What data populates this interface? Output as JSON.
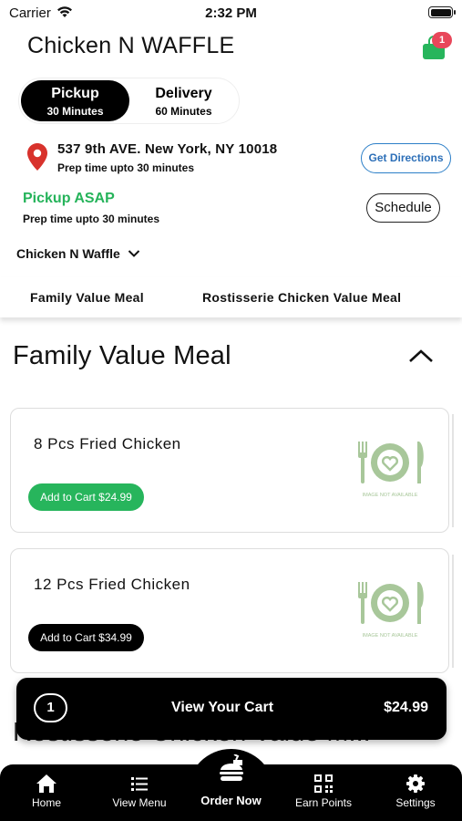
{
  "status_bar": {
    "carrier": "Carrier",
    "time": "2:32 PM"
  },
  "header": {
    "title": "Chicken N WAFFLE",
    "cart_badge": "1"
  },
  "order_mode": {
    "pickup": {
      "label": "Pickup",
      "time": "30 Minutes"
    },
    "delivery": {
      "label": "Delivery",
      "time": "60 Minutes"
    }
  },
  "location": {
    "address": "537 9th AVE. New York, NY 10018",
    "prep_time": "Prep time upto 30 minutes",
    "directions_label": "Get Directions"
  },
  "pickup": {
    "title": "Pickup ASAP",
    "prep_time": "Prep time upto 30 minutes",
    "schedule_label": "Schedule"
  },
  "store_selector": {
    "value": "Chicken N Waffle"
  },
  "category_tabs": [
    "Family Value Meal",
    "Rostisserie Chicken Value Meal"
  ],
  "section": {
    "title": "Family Value Meal"
  },
  "items": [
    {
      "name": "8 Pcs Fried Chicken",
      "button": "Add to Cart $24.99",
      "button_color": "#27b55c",
      "image_caption": "IMAGE NOT AVAILABLE"
    },
    {
      "name": "12 Pcs Fried Chicken",
      "button": "Add to Cart $34.99",
      "button_color": "#000000",
      "image_caption": "IMAGE NOT AVAILABLE"
    }
  ],
  "next_section": {
    "title": "Rostisserie Chicken Value M..."
  },
  "cart_bar": {
    "count": "1",
    "label": "View Your Cart",
    "total": "$24.99"
  },
  "tabbar": {
    "home": "Home",
    "view_menu": "View Menu",
    "order_now": "Order Now",
    "earn_points": "Earn Points",
    "settings": "Settings"
  },
  "colors": {
    "accent_green": "#25b35a",
    "link_blue": "#2c6fb8",
    "badge_red": "#e8475a",
    "placeholder_green": "#a8c79a"
  }
}
